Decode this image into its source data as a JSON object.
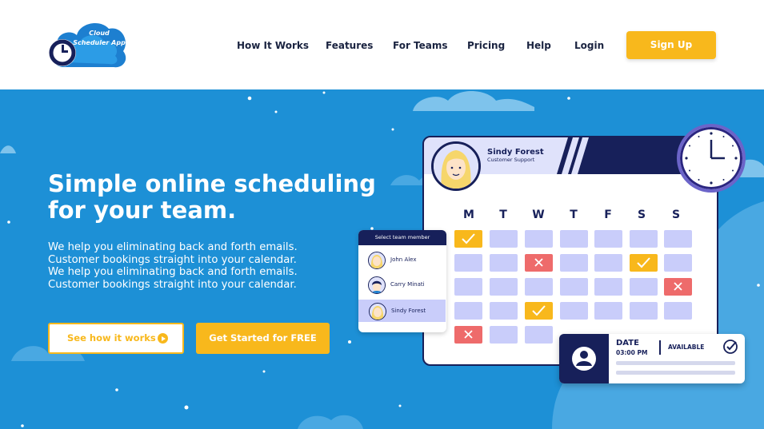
{
  "header": {
    "logo": {
      "line1": "Cloud",
      "line2": "Scheduler App",
      "icon": "cloud-clock-logo"
    },
    "nav": [
      "How It Works",
      "Features",
      "For Teams",
      "Pricing",
      "Help",
      "Login"
    ],
    "signup_label": "Sign Up"
  },
  "hero": {
    "headline": "Simple online scheduling for your team.",
    "description": [
      "We help you eliminating back and forth emails.",
      "Customer bookings straight into your calendar.",
      "We help you eliminating back and forth emails.",
      "Customer bookings straight into your calendar."
    ],
    "cta_secondary": "See how it works",
    "cta_primary": "Get Started for FREE"
  },
  "calendar": {
    "user_name": "Sindy Forest",
    "user_role": "Customer Support",
    "days": [
      "M",
      "T",
      "W",
      "T",
      "F",
      "S",
      "S"
    ]
  },
  "team_selector": {
    "title": "Select team member",
    "members": [
      "John Alex",
      "Carry Minati",
      "Sindy Forest"
    ],
    "selected": "Sindy Forest"
  },
  "booking": {
    "date_label": "DATE",
    "time": "03:00 PM",
    "status": "AVAILABLE"
  },
  "colors": {
    "hero_bg": "#1d90d6",
    "accent": "#f8b81c",
    "navy": "#17205a",
    "cell": "#c9cdfa",
    "reject": "#ee6b6b"
  }
}
